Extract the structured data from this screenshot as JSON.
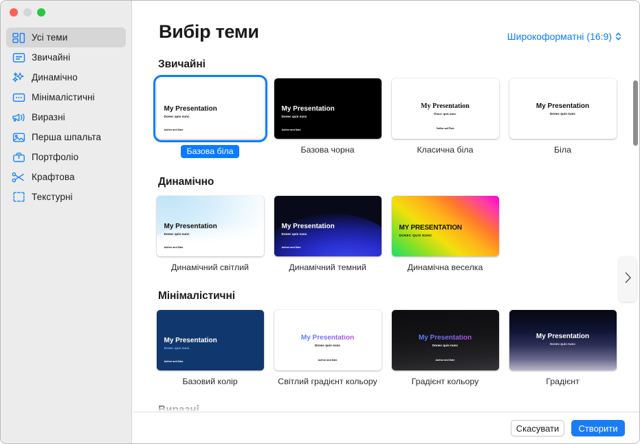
{
  "window": {
    "traffic_lights": [
      "close",
      "minimize",
      "zoom"
    ]
  },
  "sidebar": {
    "items": [
      {
        "label": "Усі теми",
        "icon": "all-themes-icon",
        "selected": true
      },
      {
        "label": "Звичайні",
        "icon": "basic-icon",
        "selected": false
      },
      {
        "label": "Динамічно",
        "icon": "sparkles-icon",
        "selected": false
      },
      {
        "label": "Мінімалістичні",
        "icon": "minimal-icon",
        "selected": false
      },
      {
        "label": "Виразні",
        "icon": "megaphone-icon",
        "selected": false
      },
      {
        "label": "Перша шпальта",
        "icon": "photo-icon",
        "selected": false
      },
      {
        "label": "Портфоліо",
        "icon": "briefcase-icon",
        "selected": false
      },
      {
        "label": "Крафтова",
        "icon": "scissors-icon",
        "selected": false
      },
      {
        "label": "Текстурні",
        "icon": "texture-icon",
        "selected": false
      }
    ]
  },
  "header": {
    "title": "Вибір теми",
    "ratio_label": "Широкоформатні (16:9)",
    "ratio_icon": "chevron-up-down-icon",
    "accent_color": "#0a7bff"
  },
  "slide_text": {
    "title": "My Presentation",
    "title_upper": "MY PRESENTATION",
    "subtitle": "Donec quis nunc",
    "author": "Author and Date"
  },
  "sections": [
    {
      "title": "Звичайні",
      "themes": [
        {
          "label": "Базова біла",
          "selected": true
        },
        {
          "label": "Базова чорна",
          "selected": false
        },
        {
          "label": "Класична біла",
          "selected": false
        },
        {
          "label": "Біла",
          "selected": false
        }
      ]
    },
    {
      "title": "Динамічно",
      "themes": [
        {
          "label": "Динамічний світлий",
          "selected": false
        },
        {
          "label": "Динамічний темний",
          "selected": false
        },
        {
          "label": "Динамічна веселка",
          "selected": false
        }
      ]
    },
    {
      "title": "Мінімалістичні",
      "themes": [
        {
          "label": "Базовий колір",
          "selected": false
        },
        {
          "label": "Світлий градієнт кольору",
          "selected": false
        },
        {
          "label": "Градієнт кольору",
          "selected": false
        },
        {
          "label": "Градієнт",
          "selected": false
        }
      ]
    },
    {
      "title": "Виразні",
      "themes": []
    }
  ],
  "nav": {
    "next_icon": "chevron-right-icon"
  },
  "footer": {
    "cancel_label": "Скасувати",
    "create_label": "Створити",
    "create_color": "#1a7cf5"
  }
}
